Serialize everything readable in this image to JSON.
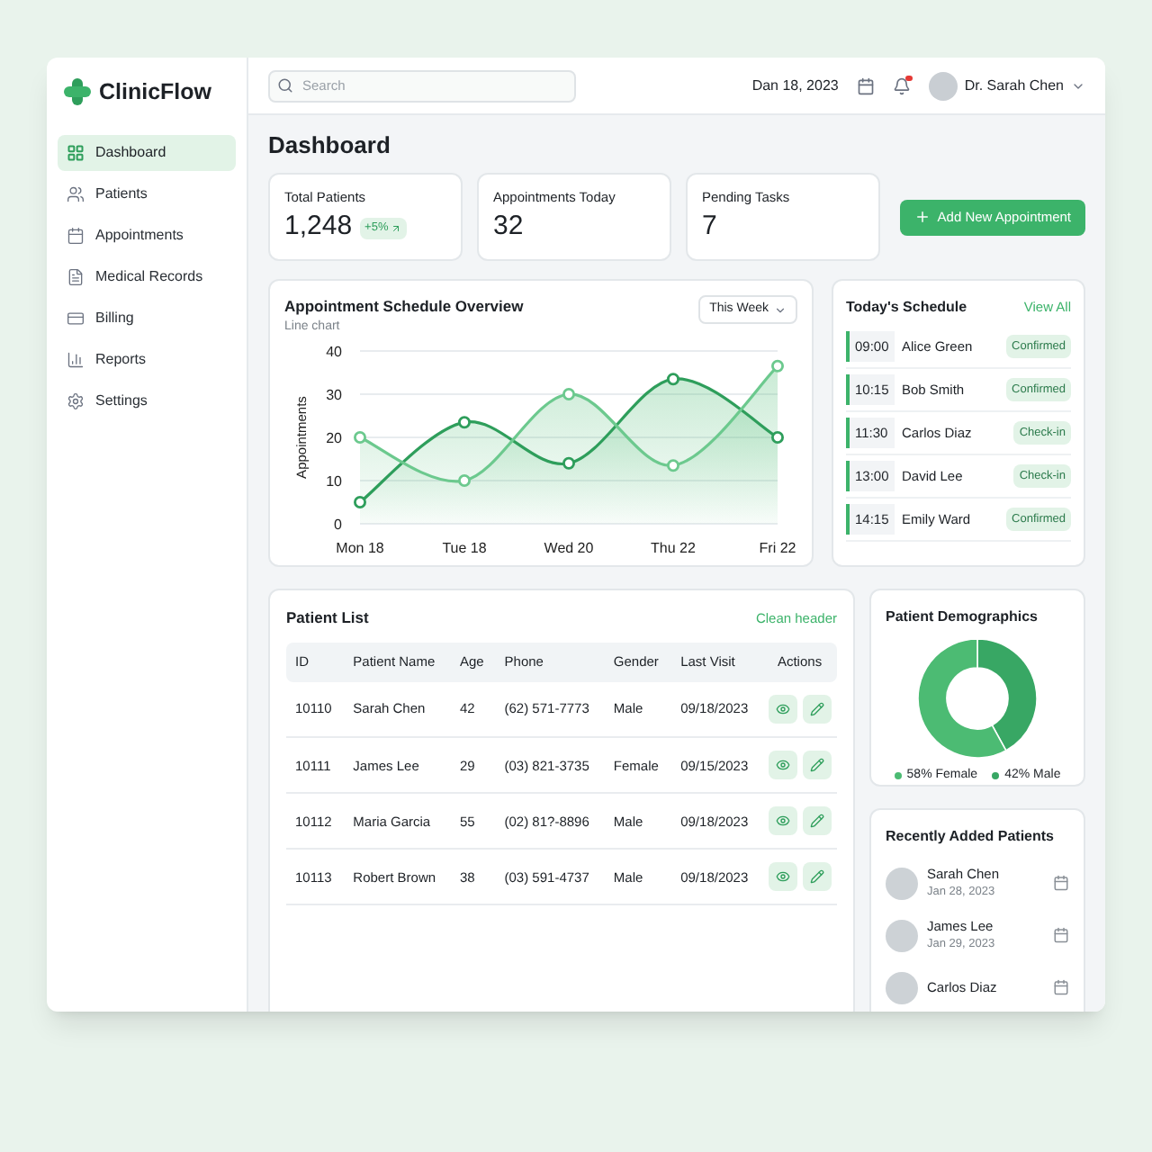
{
  "app": {
    "name": "ClinicFlow"
  },
  "sidebar": {
    "items": [
      {
        "label": "Dashboard",
        "selected": true
      },
      {
        "label": "Patients",
        "selected": false
      },
      {
        "label": "Appointments",
        "selected": false
      },
      {
        "label": "Medical Records",
        "selected": false
      },
      {
        "label": "Billing",
        "selected": false
      },
      {
        "label": "Reports",
        "selected": false
      },
      {
        "label": "Settings",
        "selected": false
      }
    ]
  },
  "header": {
    "search": {
      "placeholder": "Search"
    },
    "date": "Dan 18, 2023",
    "notifications": {
      "unread": true
    },
    "user": "Dr. Sarah Chen"
  },
  "page_title": "Dashboard",
  "stats": [
    {
      "label": "Total Patients",
      "value": "1,248",
      "badge": "+5%"
    },
    {
      "label": "Appointments Today",
      "value": "32"
    },
    {
      "label": "Pending Tasks",
      "value": "7"
    }
  ],
  "add_button": "Add New Appointment",
  "schedule_chart": {
    "title": "Appointment Schedule Overview",
    "subtitle": "Line chart",
    "range": "This Week",
    "chart_data": {
      "type": "area",
      "grid": true,
      "ylabel": "Appointments",
      "categories": [
        "Mon 18",
        "Tue 18",
        "Wed 20",
        "Thu 22",
        "Fri 22"
      ],
      "ylim": [
        0,
        40
      ],
      "yticks": [
        0,
        10,
        20,
        30,
        40
      ],
      "series": [
        {
          "color": "#2e9e5b",
          "marker": "o",
          "values": [
            5,
            23.5,
            14,
            33.5,
            20
          ]
        },
        {
          "color": "#6cc98e",
          "marker": "o",
          "values": [
            20,
            10,
            30,
            13.5,
            36.5
          ]
        }
      ]
    }
  },
  "todays_schedule": {
    "title": "Today's Schedule",
    "link": "View All",
    "items": [
      {
        "time": "09:00",
        "name": "Alice Green",
        "status": "Confirmed"
      },
      {
        "time": "10:15",
        "name": "Bob Smith",
        "status": "Confirmed"
      },
      {
        "time": "11:30",
        "name": "Carlos Diaz",
        "status": "Check-in"
      },
      {
        "time": "13:00",
        "name": "David Lee",
        "status": "Check-in"
      },
      {
        "time": "14:15",
        "name": "Emily Ward",
        "status": "Confirmed"
      }
    ]
  },
  "patient_list": {
    "title": "Patient List",
    "link": "Clean header",
    "columns": [
      "ID",
      "Patient Name",
      "Age",
      "Phone",
      "Gender",
      "Last Visit",
      "Actions"
    ],
    "rows": [
      [
        "10110",
        "Sarah Chen",
        "42",
        "(62) 571-7773",
        "Male",
        "09/18/2023"
      ],
      [
        "10111",
        "James Lee",
        "29",
        "(03) 821-3735",
        "Female",
        "09/15/2023"
      ],
      [
        "10112",
        "Maria Garcia",
        "55",
        "(02) 81?-8896",
        "Male",
        "09/18/2023"
      ],
      [
        "10113",
        "Robert Brown",
        "38",
        "(03) 591-4737",
        "Male",
        "09/18/2023"
      ]
    ]
  },
  "demographics": {
    "title": "Patient Demographics",
    "chart_data": {
      "type": "donut",
      "values": [
        58,
        42
      ],
      "colors": [
        "#4cbb73",
        "#38a764"
      ]
    },
    "legend": [
      {
        "label": "58% Female",
        "color": "#4cbb73"
      },
      {
        "label": "42% Male",
        "color": "#38a764"
      }
    ]
  },
  "recent_patients": {
    "title": "Recently Added Patients",
    "items": [
      {
        "name": "Sarah Chen",
        "date": "Jan 28, 2023"
      },
      {
        "name": "James Lee",
        "date": "Jan 29, 2023"
      },
      {
        "name": "Carlos Diaz"
      }
    ]
  }
}
